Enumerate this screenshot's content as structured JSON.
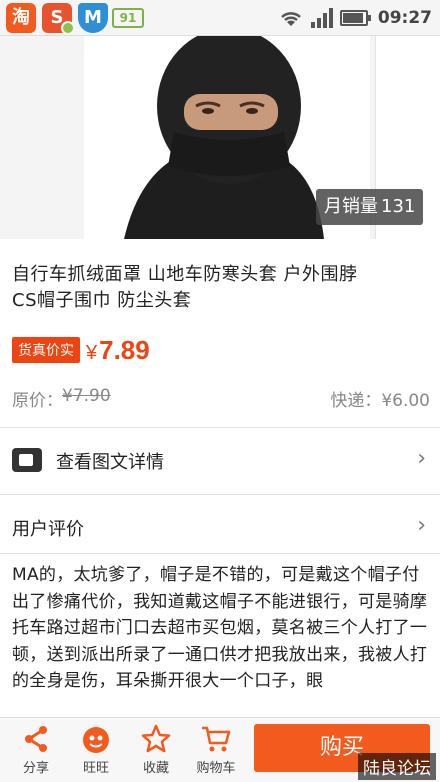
{
  "status_bar": {
    "taobao_icon_text": "淘",
    "s_icon_text": "S",
    "m_icon_text": "M",
    "app_badge": "91",
    "time": "09:27"
  },
  "product": {
    "sales_label": "月销量",
    "sales_count": "131",
    "title_line1": "自行车抓绒面罩 山地车防寒头套 户外围脖",
    "title_line2": "CS帽子围巾 防尘头套",
    "price_tag": "货真价实",
    "currency": "¥",
    "price": "7.89",
    "original_label": "原价：",
    "original_price": "¥7.90",
    "shipping": "快递：¥6.00"
  },
  "rows": {
    "details_label": "查看图文详情",
    "reviews_label": "用户评价"
  },
  "review_text": "MA的，太坑爹了，帽子是不错的，可是戴这个帽子付出了惨痛代价，我知道戴这帽子不能进银行，可是骑摩托车路过超市门口去超市买包烟，莫名被三个人打了一顿，送到派出所录了一通口供才把我放出来，我被人打的全身是伤，耳朵撕开很大一个口子，眼",
  "bottom_bar": {
    "share": "分享",
    "wangwang": "旺旺",
    "favorite": "收藏",
    "cart": "购物车",
    "buy": "购买"
  },
  "watermark": "陆良论坛",
  "colors": {
    "accent": "#f25a1e",
    "price": "#ee4411"
  }
}
